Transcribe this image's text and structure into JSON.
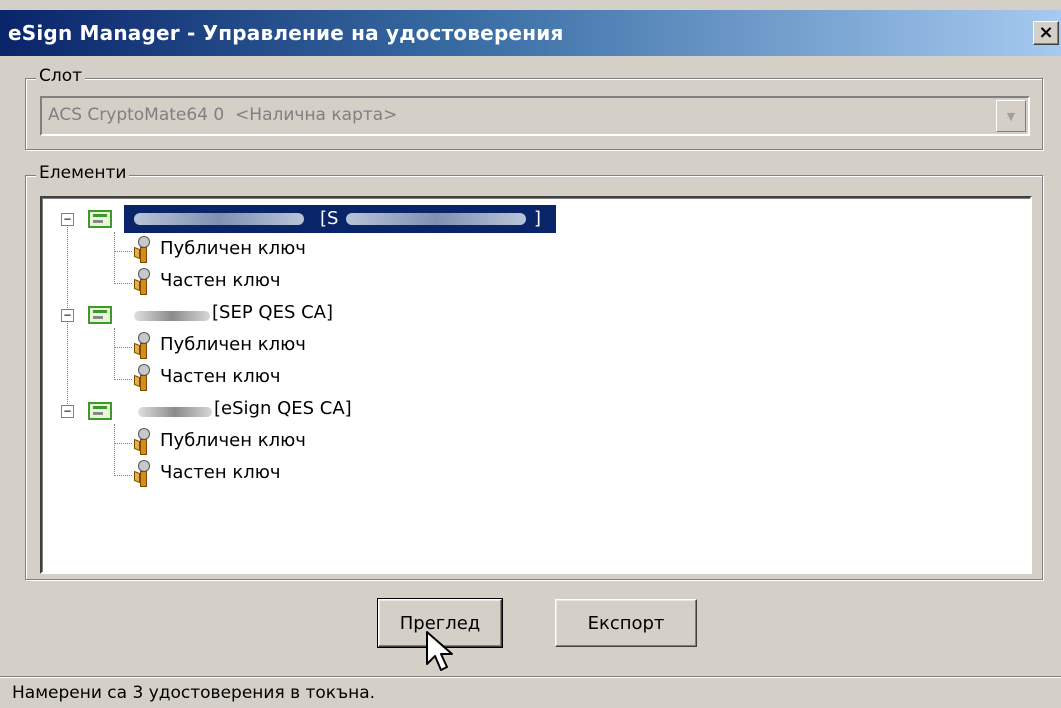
{
  "window": {
    "title": "eSign Manager - Управление на удостоверения",
    "close_label": "×"
  },
  "slot": {
    "group_label": "Слот",
    "selected_value": "ACS CryptoMate64 0  <Налична карта>"
  },
  "elements": {
    "group_label": "Елементи",
    "certificates": [
      {
        "issuer": "[S",
        "issuer_end": "]",
        "selected": true,
        "children": [
          "Публичен ключ",
          "Частен ключ"
        ]
      },
      {
        "issuer": "[SEP QES CA]",
        "selected": false,
        "children": [
          "Публичен ключ",
          "Частен ключ"
        ]
      },
      {
        "issuer": "[eSign QES CA]",
        "selected": false,
        "children": [
          "Публичен ключ",
          "Частен ключ"
        ]
      }
    ]
  },
  "buttons": {
    "preview": "Преглед",
    "export": "Експорт"
  },
  "status": {
    "text": "Намерени са 3 удостоверения в токъна."
  },
  "colors": {
    "title_gradient_start": "#0a246a",
    "title_gradient_end": "#a6caf0",
    "selection": "#0a246a",
    "dialog_bg": "#d4d0c8"
  },
  "icons": {
    "certificate": "certificate-icon",
    "key": "key-icon",
    "close": "close-icon",
    "dropdown": "chevron-down-icon",
    "cursor": "mouse-pointer-icon"
  }
}
